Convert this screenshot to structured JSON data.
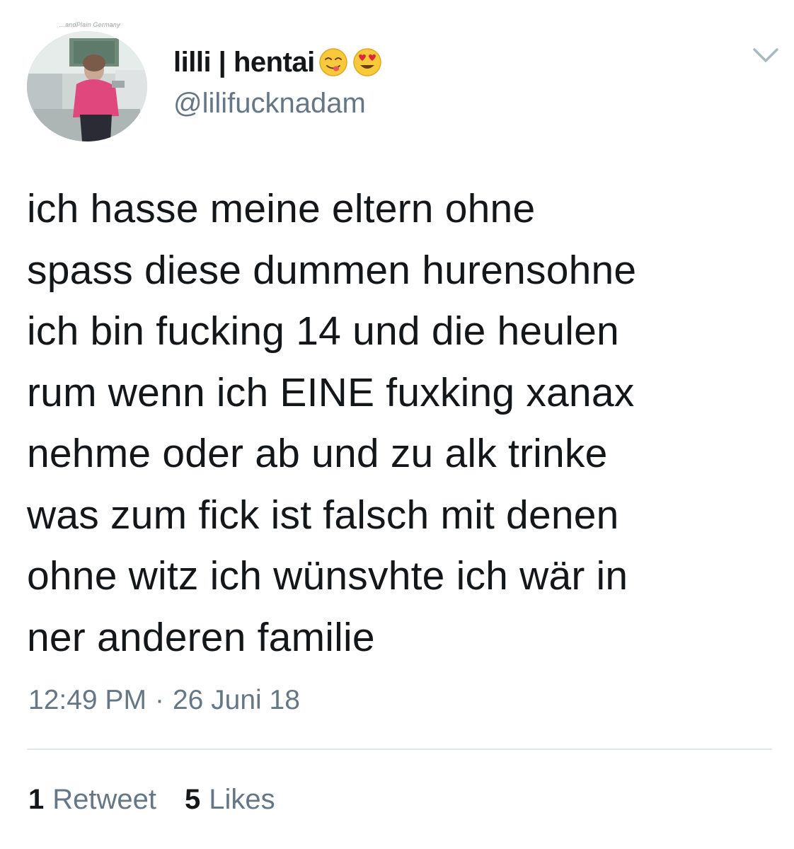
{
  "user": {
    "display_name": "lilli | hentai",
    "handle": "@lilifucknadam",
    "name_emojis": [
      "savoring-food-face-icon",
      "heart-eyes-face-icon"
    ],
    "avatar_caption": "...andPlain Germany"
  },
  "tweet": {
    "text": "ich hasse meine eltern ohne\nspass diese dummen hurensohne\nich bin fucking 14 und die heulen\nrum wenn ich EINE fuxking xanax\nnehme oder ab und zu alk trinke\nwas zum fick ist falsch mit denen\nohne witz ich wünsvhte ich wär in\nner anderen familie",
    "time": "12:49 PM",
    "separator": "·",
    "date": "26 Juni 18"
  },
  "stats": {
    "retweets_count": "1",
    "retweets_label": "Retweet",
    "likes_count": "5",
    "likes_label": "Likes"
  },
  "colors": {
    "text_primary": "#14171a",
    "text_secondary": "#657786",
    "divider": "#e1e8ed",
    "background": "#ffffff"
  }
}
